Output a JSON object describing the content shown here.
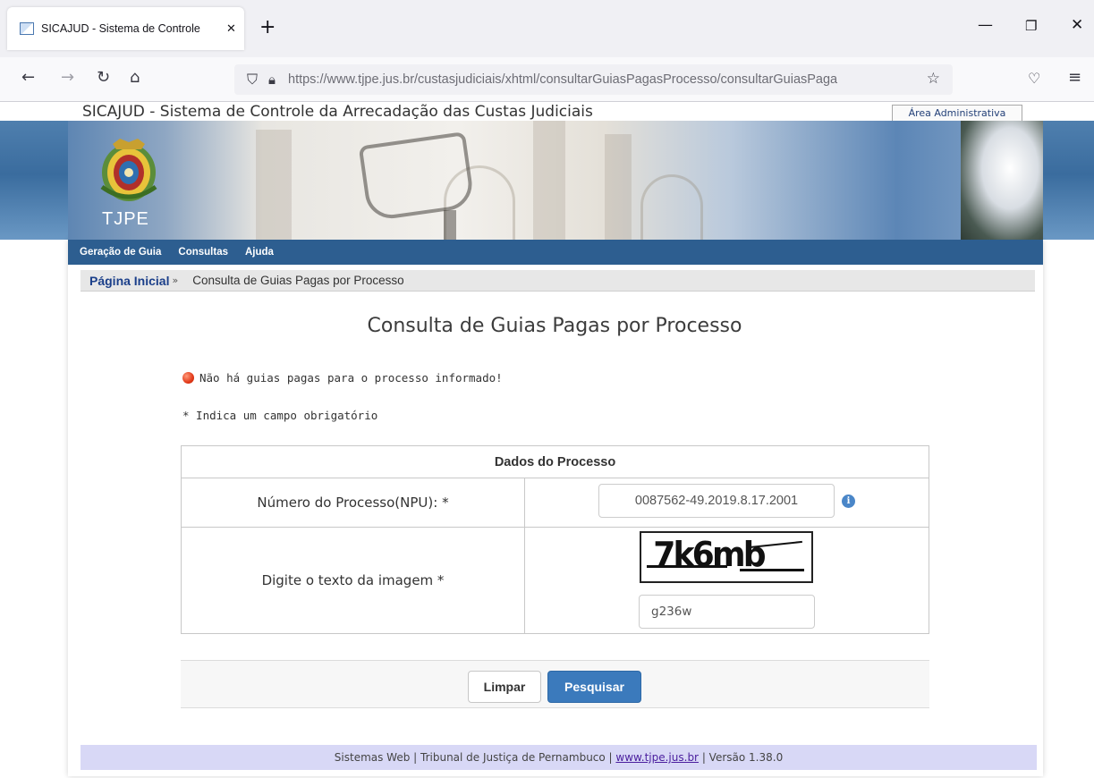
{
  "browser": {
    "tab_title": "SICAJUD - Sistema de Controle",
    "url": "https://www.tjpe.jus.br/custasjudiciais/xhtml/consultarGuiasPagasProcesso/consultarGuiasPaga",
    "url_domain_bold": "tjpe.jus.br"
  },
  "header": {
    "site_title": "SICAJUD - Sistema de Controle da Arrecadação das Custas Judiciais",
    "admin_link": "Área Administrativa",
    "logo_label": "TJPE"
  },
  "menu": {
    "items": [
      "Geração de Guia",
      "Consultas",
      "Ajuda"
    ]
  },
  "breadcrumb": {
    "home": "Página Inicial",
    "separator": "»",
    "current": "Consulta de Guias Pagas por Processo"
  },
  "main": {
    "title": "Consulta de Guias Pagas por Processo",
    "message": "Não há guias pagas para o processo informado!",
    "required_note": "* Indica um campo obrigatório",
    "table_header": "Dados do Processo",
    "npu_label": "Número do Processo(NPU): *",
    "npu_value": "0087562-49.2019.8.17.2001",
    "info_icon": "i",
    "captcha_label": "Digite o texto da imagem *",
    "captcha_image_text": "7k6mb",
    "captcha_value": "g236w"
  },
  "buttons": {
    "clear": "Limpar",
    "search": "Pesquisar"
  },
  "footer": {
    "prefix": "Sistemas Web | Tribunal de Justiça de Pernambuco |",
    "link": "www.tjpe.jus.br",
    "suffix": "| Versão 1.38.0"
  },
  "colors": {
    "menu_bg": "#2d5e90",
    "primary_button": "#3b7abc",
    "footer_bg": "#d8d8f6",
    "error_dot": "#e23a1a"
  },
  "icons": {
    "back": "arrow-left-icon",
    "forward": "arrow-right-icon",
    "reload": "reload-icon",
    "home": "home-icon",
    "shield": "shield-icon",
    "lock": "lock-icon",
    "bookmark": "star-icon",
    "pocket": "pocket-icon",
    "menu": "hamburger-icon"
  }
}
